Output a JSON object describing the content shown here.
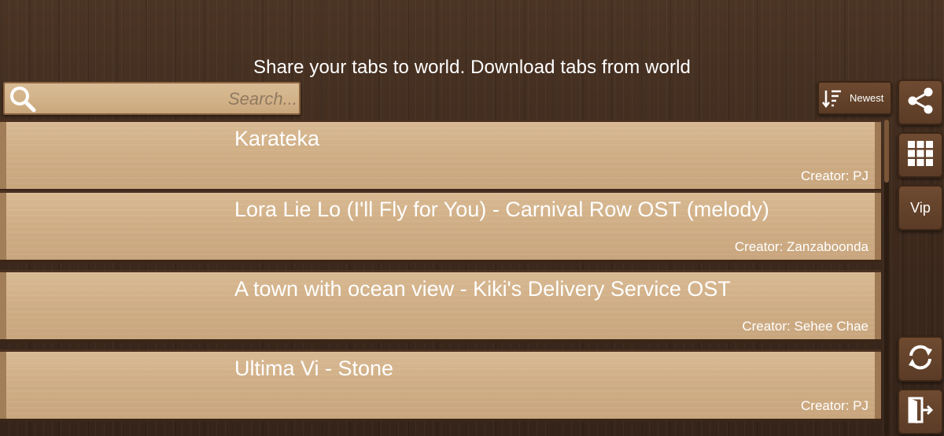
{
  "header": {
    "tagline": "Share your tabs to world. Download tabs from world"
  },
  "search": {
    "placeholder": "Search...",
    "value": "",
    "icon": "search-icon"
  },
  "sort": {
    "label": "Newest",
    "icon": "sort-descending-icon"
  },
  "side_buttons": {
    "share_icon": "share-icon",
    "grid_icon": "grid-icon",
    "vip_label": "Vip",
    "refresh_icon": "refresh-icon",
    "exit_icon": "exit-door-icon"
  },
  "tabs": [
    {
      "title": "Karateka",
      "creator": "Creator: PJ"
    },
    {
      "title": "Lora Lie Lo (I'll Fly for You) - Carnival Row OST (melody)",
      "creator": "Creator: Zanzaboonda"
    },
    {
      "title": "A town with ocean view - Kiki's Delivery Service OST",
      "creator": "Creator: Sehee Chae"
    },
    {
      "title": "Ultima Vi - Stone",
      "creator": "Creator: PJ"
    }
  ],
  "colors": {
    "wood_dark": "#3e2a1d",
    "plank": "#d2b187",
    "text": "#ffffff",
    "placeholder": "#8f7a61"
  }
}
